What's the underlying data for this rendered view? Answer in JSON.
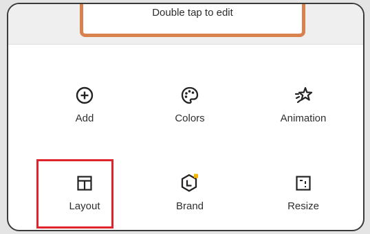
{
  "edit_hint": "Double tap to edit",
  "tools": {
    "add": {
      "label": "Add",
      "icon": "plus-circle-icon"
    },
    "colors": {
      "label": "Colors",
      "icon": "palette-icon"
    },
    "animation": {
      "label": "Animation",
      "icon": "sparkle-star-icon"
    },
    "layout": {
      "label": "Layout",
      "icon": "layout-grid-icon"
    },
    "brand": {
      "label": "Brand",
      "icon": "brand-hexagon-icon"
    },
    "resize": {
      "label": "Resize",
      "icon": "resize-icon"
    }
  },
  "colors": {
    "highlight": "#e0232a",
    "card_border": "#d9824f",
    "brand_badge": "#f5b400"
  }
}
